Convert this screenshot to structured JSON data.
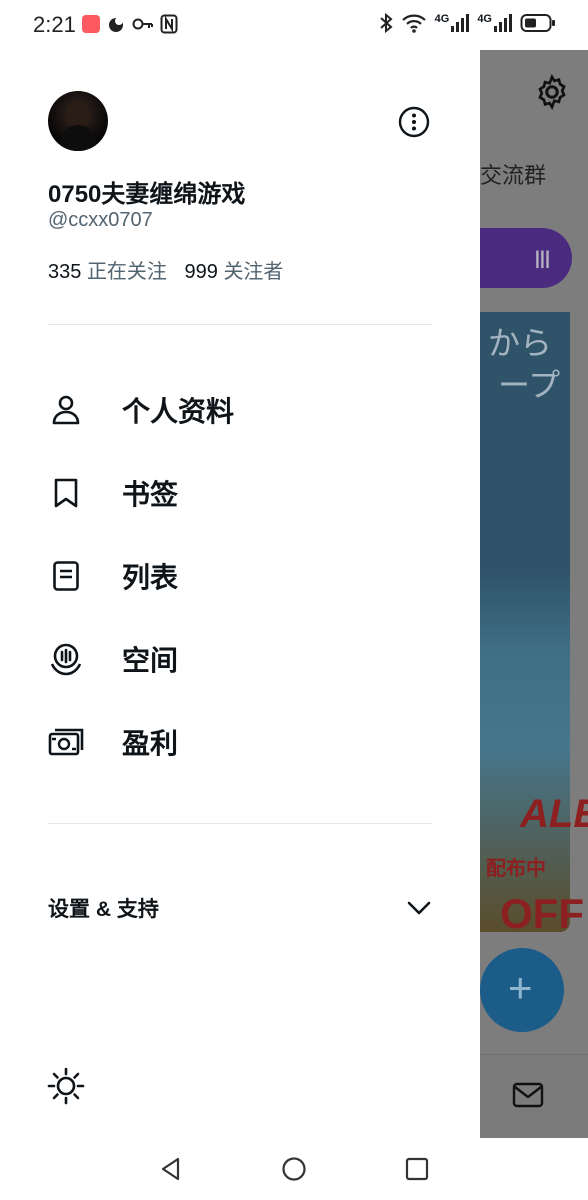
{
  "status_bar": {
    "time": "2:21",
    "network_left": "4G",
    "network_right": "4G",
    "icons": [
      "app-notification-icon",
      "app-icon",
      "key-icon",
      "nfc-icon",
      "bluetooth-icon",
      "wifi-icon",
      "signal-icon",
      "signal-icon",
      "battery-icon"
    ]
  },
  "background_app": {
    "group_text": "交流群",
    "banner_line1": "から",
    "banner_line2": "ープ",
    "banner_sale": "ALE",
    "banner_distribution": "配布中",
    "banner_off": "OFF",
    "fab_label": "+"
  },
  "drawer": {
    "profile": {
      "display_name": "0750夫妻缠绵游戏",
      "handle": "@ccxx0707",
      "following_count": "335",
      "following_label": "正在关注",
      "followers_count": "999",
      "followers_label": "关注者"
    },
    "menu": [
      {
        "label": "个人资料",
        "icon": "person-icon"
      },
      {
        "label": "书签",
        "icon": "bookmark-icon"
      },
      {
        "label": "列表",
        "icon": "list-icon"
      },
      {
        "label": "空间",
        "icon": "spaces-icon"
      },
      {
        "label": "盈利",
        "icon": "monetization-icon"
      }
    ],
    "settings_support_label": "设置 & 支持"
  },
  "colors": {
    "primary_text": "#0f1419",
    "secondary_text": "#536471",
    "divider": "#e6e9ec",
    "overlay": "#7d7d7d"
  }
}
